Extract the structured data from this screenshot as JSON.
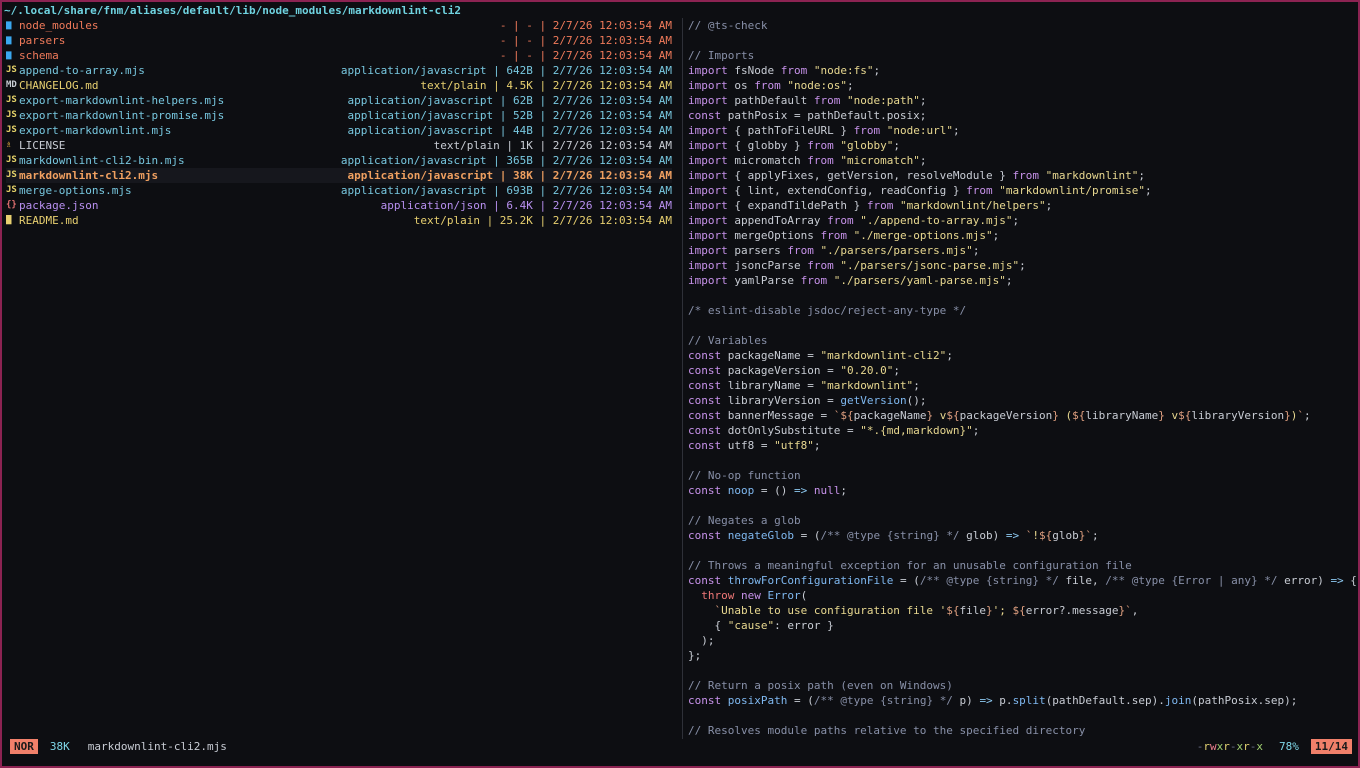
{
  "path": "~/.local/share/fnm/aliases/default/lib/node_modules/markdownlint-cli2",
  "colors": {
    "dir": "#3aa8f0",
    "dir_name": "#f07a5a",
    "js": "#78c8e0",
    "js_icon": "#e8d56a",
    "text": "#c8ccd4",
    "md_icon": "#c8ccd4",
    "license_icon": "#e8b440",
    "selected": "#f0a060",
    "json": "#b890f0",
    "json_icon": "#e07070",
    "readme": "#e8d070",
    "comment": "#8890a8",
    "keyword": "#c792ea",
    "string": "#e8d890",
    "fn": "#7fb8f0",
    "plain": "#c8ccd4",
    "op": "#8cc8f0",
    "tmpl": "#e0a080",
    "red": "#f07878",
    "types": "#c8ccd4"
  },
  "files": [
    {
      "icon": "▆",
      "icon_color": "dir",
      "name": "node_modules",
      "name_color": "dir_name",
      "meta": "- | - | 2/7/26 12:03:54 AM",
      "meta_color": "dir_name"
    },
    {
      "icon": "▆",
      "icon_color": "dir",
      "name": "parsers",
      "name_color": "dir_name",
      "meta": "- | - | 2/7/26 12:03:54 AM",
      "meta_color": "dir_name"
    },
    {
      "icon": "▆",
      "icon_color": "dir",
      "name": "schema",
      "name_color": "dir_name",
      "meta": "- | - | 2/7/26 12:03:54 AM",
      "meta_color": "dir_name"
    },
    {
      "icon": "JS",
      "icon_color": "js_icon",
      "name": "append-to-array.mjs",
      "name_color": "js",
      "meta": "application/javascript | 642B | 2/7/26 12:03:54 AM",
      "meta_color": "js"
    },
    {
      "icon": "MD",
      "icon_color": "md_icon",
      "name": "CHANGELOG.md",
      "name_color": "readme",
      "meta": "text/plain | 4.5K | 2/7/26 12:03:54 AM",
      "meta_color": "readme"
    },
    {
      "icon": "JS",
      "icon_color": "js_icon",
      "name": "export-markdownlint-helpers.mjs",
      "name_color": "js",
      "meta": "application/javascript | 62B | 2/7/26 12:03:54 AM",
      "meta_color": "js"
    },
    {
      "icon": "JS",
      "icon_color": "js_icon",
      "name": "export-markdownlint-promise.mjs",
      "name_color": "js",
      "meta": "application/javascript | 52B | 2/7/26 12:03:54 AM",
      "meta_color": "js"
    },
    {
      "icon": "JS",
      "icon_color": "js_icon",
      "name": "export-markdownlint.mjs",
      "name_color": "js",
      "meta": "application/javascript | 44B | 2/7/26 12:03:54 AM",
      "meta_color": "js"
    },
    {
      "icon": "♗",
      "icon_color": "license_icon",
      "name": "LICENSE",
      "name_color": "text",
      "meta": "text/plain | 1K | 2/7/26 12:03:54 AM",
      "meta_color": "text"
    },
    {
      "icon": "JS",
      "icon_color": "js_icon",
      "name": "markdownlint-cli2-bin.mjs",
      "name_color": "js",
      "meta": "application/javascript | 365B | 2/7/26 12:03:54 AM",
      "meta_color": "js"
    },
    {
      "icon": "JS",
      "icon_color": "js_icon",
      "name": "markdownlint-cli2.mjs",
      "name_color": "selected",
      "meta": "application/javascript | 38K | 2/7/26 12:03:54 AM",
      "meta_color": "selected",
      "selected": true
    },
    {
      "icon": "JS",
      "icon_color": "js_icon",
      "name": "merge-options.mjs",
      "name_color": "js",
      "meta": "application/javascript | 693B | 2/7/26 12:03:54 AM",
      "meta_color": "js"
    },
    {
      "icon": "{}",
      "icon_color": "json_icon",
      "name": "package.json",
      "name_color": "json",
      "meta": "application/json | 6.4K | 2/7/26 12:03:54 AM",
      "meta_color": "json"
    },
    {
      "icon": "▇",
      "icon_color": "readme",
      "name": "README.md",
      "name_color": "readme",
      "meta": "text/plain | 25.2K | 2/7/26 12:03:54 AM",
      "meta_color": "readme"
    }
  ],
  "code": [
    [
      [
        "comment",
        "// @ts-check"
      ]
    ],
    [],
    [
      [
        "comment",
        "// Imports"
      ]
    ],
    [
      [
        "keyword",
        "import"
      ],
      [
        "plain",
        " fsNode "
      ],
      [
        "keyword",
        "from"
      ],
      [
        "plain",
        " "
      ],
      [
        "string",
        "\"node:fs\""
      ],
      [
        "plain",
        ";"
      ]
    ],
    [
      [
        "keyword",
        "import"
      ],
      [
        "plain",
        " os "
      ],
      [
        "keyword",
        "from"
      ],
      [
        "plain",
        " "
      ],
      [
        "string",
        "\"node:os\""
      ],
      [
        "plain",
        ";"
      ]
    ],
    [
      [
        "keyword",
        "import"
      ],
      [
        "plain",
        " pathDefault "
      ],
      [
        "keyword",
        "from"
      ],
      [
        "plain",
        " "
      ],
      [
        "string",
        "\"node:path\""
      ],
      [
        "plain",
        ";"
      ]
    ],
    [
      [
        "keyword",
        "const"
      ],
      [
        "plain",
        " pathPosix = pathDefault.posix;"
      ]
    ],
    [
      [
        "keyword",
        "import"
      ],
      [
        "plain",
        " { pathToFileURL } "
      ],
      [
        "keyword",
        "from"
      ],
      [
        "plain",
        " "
      ],
      [
        "string",
        "\"node:url\""
      ],
      [
        "plain",
        ";"
      ]
    ],
    [
      [
        "keyword",
        "import"
      ],
      [
        "plain",
        " { globby } "
      ],
      [
        "keyword",
        "from"
      ],
      [
        "plain",
        " "
      ],
      [
        "string",
        "\"globby\""
      ],
      [
        "plain",
        ";"
      ]
    ],
    [
      [
        "keyword",
        "import"
      ],
      [
        "plain",
        " micromatch "
      ],
      [
        "keyword",
        "from"
      ],
      [
        "plain",
        " "
      ],
      [
        "string",
        "\"micromatch\""
      ],
      [
        "plain",
        ";"
      ]
    ],
    [
      [
        "keyword",
        "import"
      ],
      [
        "plain",
        " { applyFixes, getVersion, resolveModule } "
      ],
      [
        "keyword",
        "from"
      ],
      [
        "plain",
        " "
      ],
      [
        "string",
        "\"markdownlint\""
      ],
      [
        "plain",
        ";"
      ]
    ],
    [
      [
        "keyword",
        "import"
      ],
      [
        "plain",
        " { lint, extendConfig, readConfig } "
      ],
      [
        "keyword",
        "from"
      ],
      [
        "plain",
        " "
      ],
      [
        "string",
        "\"markdownlint/promise\""
      ],
      [
        "plain",
        ";"
      ]
    ],
    [
      [
        "keyword",
        "import"
      ],
      [
        "plain",
        " { expandTildePath } "
      ],
      [
        "keyword",
        "from"
      ],
      [
        "plain",
        " "
      ],
      [
        "string",
        "\"markdownlint/helpers\""
      ],
      [
        "plain",
        ";"
      ]
    ],
    [
      [
        "keyword",
        "import"
      ],
      [
        "plain",
        " appendToArray "
      ],
      [
        "keyword",
        "from"
      ],
      [
        "plain",
        " "
      ],
      [
        "string",
        "\"./append-to-array.mjs\""
      ],
      [
        "plain",
        ";"
      ]
    ],
    [
      [
        "keyword",
        "import"
      ],
      [
        "plain",
        " mergeOptions "
      ],
      [
        "keyword",
        "from"
      ],
      [
        "plain",
        " "
      ],
      [
        "string",
        "\"./merge-options.mjs\""
      ],
      [
        "plain",
        ";"
      ]
    ],
    [
      [
        "keyword",
        "import"
      ],
      [
        "plain",
        " parsers "
      ],
      [
        "keyword",
        "from"
      ],
      [
        "plain",
        " "
      ],
      [
        "string",
        "\"./parsers/parsers.mjs\""
      ],
      [
        "plain",
        ";"
      ]
    ],
    [
      [
        "keyword",
        "import"
      ],
      [
        "plain",
        " jsoncParse "
      ],
      [
        "keyword",
        "from"
      ],
      [
        "plain",
        " "
      ],
      [
        "string",
        "\"./parsers/jsonc-parse.mjs\""
      ],
      [
        "plain",
        ";"
      ]
    ],
    [
      [
        "keyword",
        "import"
      ],
      [
        "plain",
        " yamlParse "
      ],
      [
        "keyword",
        "from"
      ],
      [
        "plain",
        " "
      ],
      [
        "string",
        "\"./parsers/yaml-parse.mjs\""
      ],
      [
        "plain",
        ";"
      ]
    ],
    [],
    [
      [
        "comment",
        "/* eslint-disable jsdoc/reject-any-type */"
      ]
    ],
    [],
    [
      [
        "comment",
        "// Variables"
      ]
    ],
    [
      [
        "keyword",
        "const"
      ],
      [
        "plain",
        " packageName = "
      ],
      [
        "string",
        "\"markdownlint-cli2\""
      ],
      [
        "plain",
        ";"
      ]
    ],
    [
      [
        "keyword",
        "const"
      ],
      [
        "plain",
        " packageVersion = "
      ],
      [
        "string",
        "\"0.20.0\""
      ],
      [
        "plain",
        ";"
      ]
    ],
    [
      [
        "keyword",
        "const"
      ],
      [
        "plain",
        " libraryName = "
      ],
      [
        "string",
        "\"markdownlint\""
      ],
      [
        "plain",
        ";"
      ]
    ],
    [
      [
        "keyword",
        "const"
      ],
      [
        "plain",
        " libraryVersion = "
      ],
      [
        "fn",
        "getVersion"
      ],
      [
        "plain",
        "();"
      ]
    ],
    [
      [
        "keyword",
        "const"
      ],
      [
        "plain",
        " bannerMessage = "
      ],
      [
        "tmpl",
        "`${"
      ],
      [
        "plain",
        "packageName"
      ],
      [
        "tmpl",
        "}"
      ],
      [
        "string",
        " v"
      ],
      [
        "tmpl",
        "${"
      ],
      [
        "plain",
        "packageVersion"
      ],
      [
        "tmpl",
        "}"
      ],
      [
        "string",
        " ("
      ],
      [
        "tmpl",
        "${"
      ],
      [
        "plain",
        "libraryName"
      ],
      [
        "tmpl",
        "}"
      ],
      [
        "string",
        " v"
      ],
      [
        "tmpl",
        "${"
      ],
      [
        "plain",
        "libraryVersion"
      ],
      [
        "tmpl",
        "}"
      ],
      [
        "string",
        ")"
      ],
      [
        "tmpl",
        "`"
      ],
      [
        "plain",
        ";"
      ]
    ],
    [
      [
        "keyword",
        "const"
      ],
      [
        "plain",
        " dotOnlySubstitute = "
      ],
      [
        "string",
        "\"*.{md,markdown}\""
      ],
      [
        "plain",
        ";"
      ]
    ],
    [
      [
        "keyword",
        "const"
      ],
      [
        "plain",
        " utf8 = "
      ],
      [
        "string",
        "\"utf8\""
      ],
      [
        "plain",
        ";"
      ]
    ],
    [],
    [
      [
        "comment",
        "// No-op function"
      ]
    ],
    [
      [
        "keyword",
        "const"
      ],
      [
        "plain",
        " "
      ],
      [
        "fn",
        "noop"
      ],
      [
        "plain",
        " = () "
      ],
      [
        "op",
        "=>"
      ],
      [
        "plain",
        " "
      ],
      [
        "keyword",
        "null"
      ],
      [
        "plain",
        ";"
      ]
    ],
    [],
    [
      [
        "comment",
        "// Negates a glob"
      ]
    ],
    [
      [
        "keyword",
        "const"
      ],
      [
        "plain",
        " "
      ],
      [
        "fn",
        "negateGlob"
      ],
      [
        "plain",
        " = ("
      ],
      [
        "comment",
        "/** @type {string} */"
      ],
      [
        "plain",
        " glob) "
      ],
      [
        "op",
        "=>"
      ],
      [
        "plain",
        " "
      ],
      [
        "tmpl",
        "`"
      ],
      [
        "string",
        "!"
      ],
      [
        "tmpl",
        "${"
      ],
      [
        "plain",
        "glob"
      ],
      [
        "tmpl",
        "}`"
      ],
      [
        "plain",
        ";"
      ]
    ],
    [],
    [
      [
        "comment",
        "// Throws a meaningful exception for an unusable configuration file"
      ]
    ],
    [
      [
        "keyword",
        "const"
      ],
      [
        "plain",
        " "
      ],
      [
        "fn",
        "throwForConfigurationFile"
      ],
      [
        "plain",
        " = ("
      ],
      [
        "comment",
        "/** @type {string} */"
      ],
      [
        "plain",
        " file, "
      ],
      [
        "comment",
        "/** @type {Error | any} */"
      ],
      [
        "plain",
        " error) "
      ],
      [
        "op",
        "=>"
      ],
      [
        "plain",
        " {"
      ]
    ],
    [
      [
        "plain",
        "  "
      ],
      [
        "red",
        "throw"
      ],
      [
        "plain",
        " "
      ],
      [
        "keyword",
        "new"
      ],
      [
        "plain",
        " "
      ],
      [
        "fn",
        "Error"
      ],
      [
        "plain",
        "("
      ]
    ],
    [
      [
        "plain",
        "    "
      ],
      [
        "tmpl",
        "`"
      ],
      [
        "string",
        "Unable to use configuration file '"
      ],
      [
        "tmpl",
        "${"
      ],
      [
        "plain",
        "file"
      ],
      [
        "tmpl",
        "}"
      ],
      [
        "string",
        "'; "
      ],
      [
        "tmpl",
        "${"
      ],
      [
        "plain",
        "error?.message"
      ],
      [
        "tmpl",
        "}`"
      ],
      [
        "plain",
        ","
      ]
    ],
    [
      [
        "plain",
        "    { "
      ],
      [
        "string",
        "\"cause\""
      ],
      [
        "plain",
        ": error }"
      ]
    ],
    [
      [
        "plain",
        "  );"
      ]
    ],
    [
      [
        "plain",
        "};"
      ]
    ],
    [],
    [
      [
        "comment",
        "// Return a posix path (even on Windows)"
      ]
    ],
    [
      [
        "keyword",
        "const"
      ],
      [
        "plain",
        " "
      ],
      [
        "fn",
        "posixPath"
      ],
      [
        "plain",
        " = ("
      ],
      [
        "comment",
        "/** @type {string} */"
      ],
      [
        "plain",
        " p) "
      ],
      [
        "op",
        "=>"
      ],
      [
        "plain",
        " p."
      ],
      [
        "fn",
        "split"
      ],
      [
        "plain",
        "(pathDefault.sep)."
      ],
      [
        "fn",
        "join"
      ],
      [
        "plain",
        "(pathPosix.sep);"
      ]
    ],
    [],
    [
      [
        "comment",
        "// Resolves module paths relative to the specified directory"
      ]
    ]
  ],
  "status": {
    "mode": "NOR",
    "size": "38K",
    "name": "markdownlint-cli2.mjs",
    "perms": "-rwxr-xr-x",
    "percent": "78%",
    "position": "11/14"
  }
}
